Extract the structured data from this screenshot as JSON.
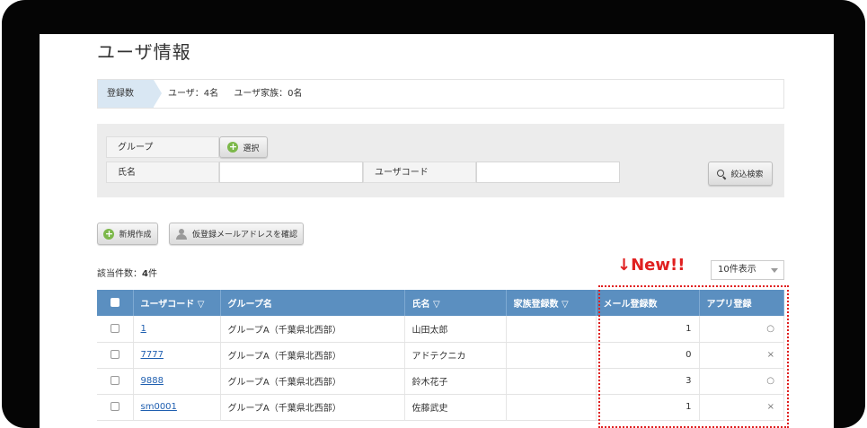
{
  "page": {
    "title": "ユーザ情報"
  },
  "summary": {
    "tag": "登録数",
    "users": "ユーザ：4名",
    "family": "ユーザ家族：0名"
  },
  "search": {
    "group_label": "グループ",
    "select_button": "選択",
    "name_label": "氏名",
    "name_value": "",
    "usercode_label": "ユーザコード",
    "usercode_value": "",
    "search_button": "絞込検索"
  },
  "actions": {
    "new_button": "新規作成",
    "confirm_button": "仮登録メールアドレスを確認"
  },
  "results": {
    "count_prefix": "該当件数：",
    "count": "4",
    "count_suffix": "件",
    "per_page": "10件表示",
    "new_label": "↓New!!"
  },
  "table": {
    "headers": [
      "ユーザコード ▽",
      "グループ名",
      "氏名 ▽",
      "家族登録数 ▽",
      "メール登録数",
      "アプリ登録"
    ],
    "rows": [
      {
        "code": "1",
        "group": "グループA（千葉県北西部）",
        "name": "山田太郎",
        "family": "",
        "mail": "1",
        "app": "○"
      },
      {
        "code": "7777",
        "group": "グループA（千葉県北西部）",
        "name": "アドテクニカ",
        "family": "",
        "mail": "0",
        "app": "×"
      },
      {
        "code": "9888",
        "group": "グループA（千葉県北西部）",
        "name": "鈴木花子",
        "family": "",
        "mail": "3",
        "app": "○"
      },
      {
        "code": "sm0001",
        "group": "グループA（千葉県北西部）",
        "name": "佐藤武史",
        "family": "",
        "mail": "1",
        "app": "×"
      }
    ]
  }
}
